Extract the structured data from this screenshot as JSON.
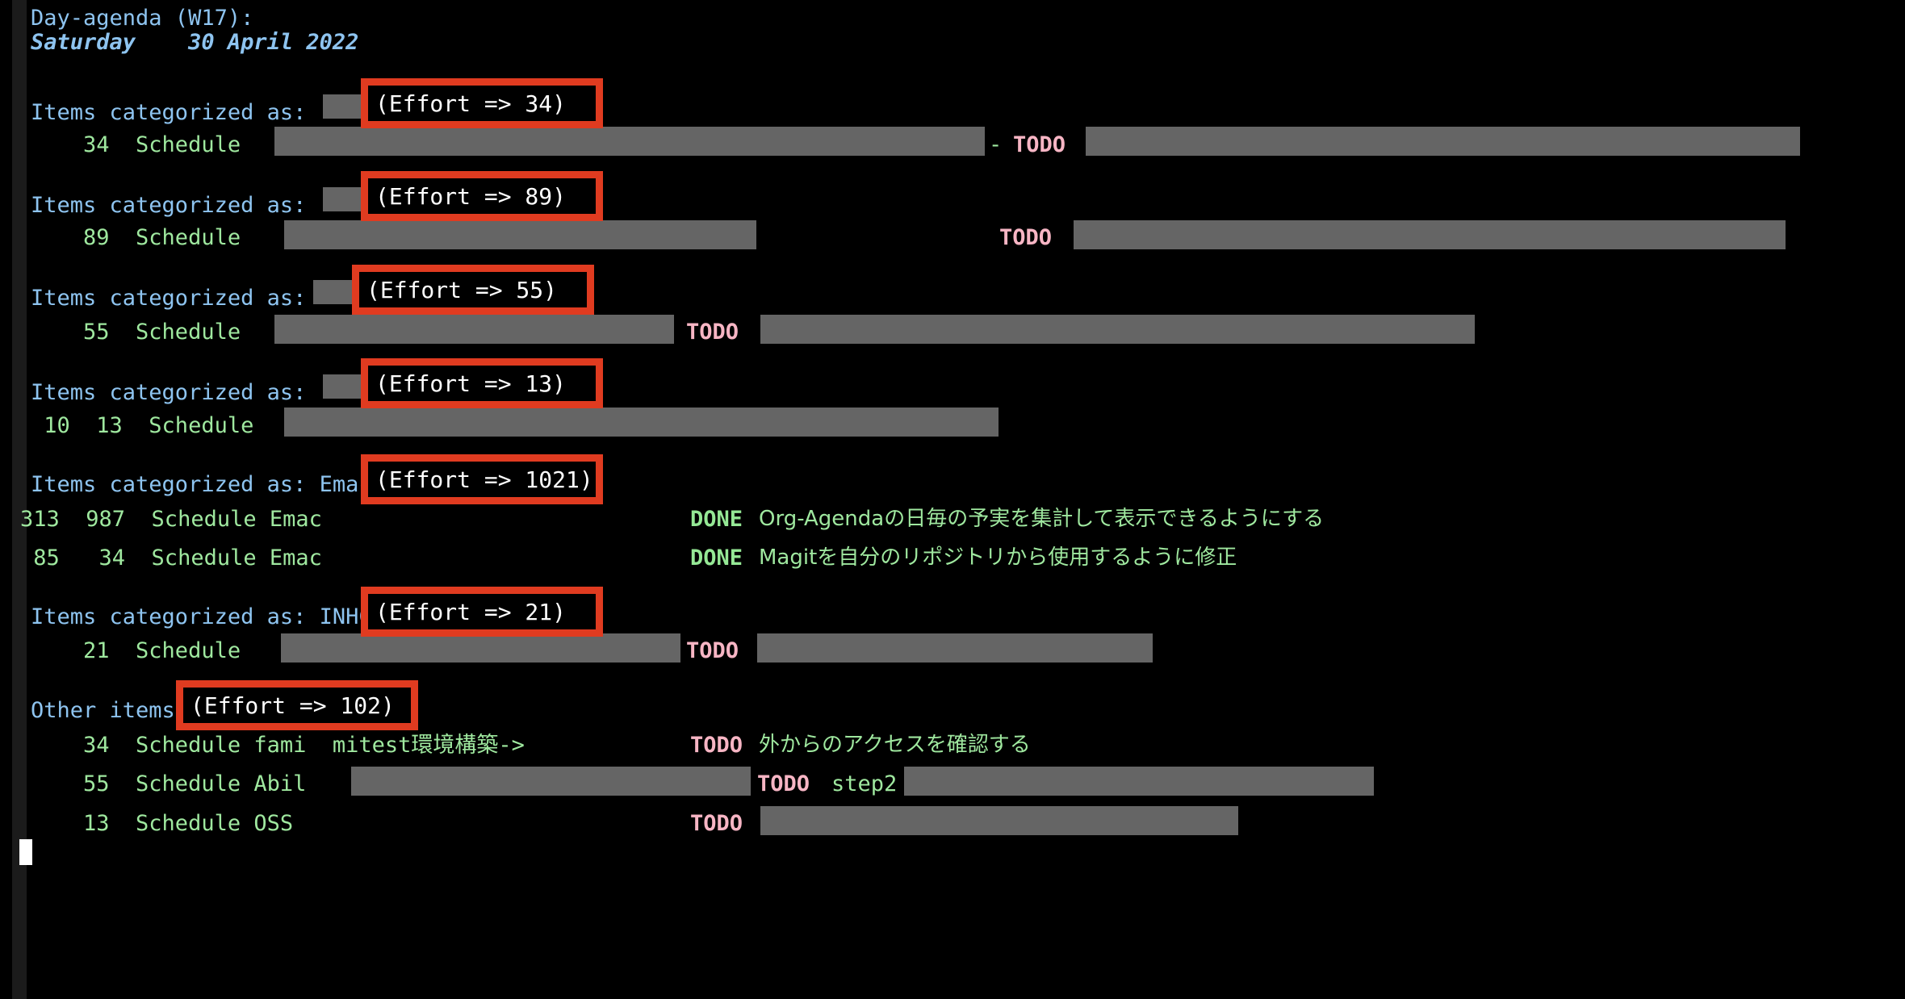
{
  "header": {
    "title": "Day-agenda (W17):",
    "date": "Saturday    30 April 2022"
  },
  "labels": {
    "items_categorized_as": "Items categorized as:",
    "other_items": "Other items",
    "schedule": "Schedule",
    "todo_keyword": "TODO",
    "done_keyword": "DONE"
  },
  "colors": {
    "background": "#000000",
    "fringe": "#1b1b1b",
    "header_blue": "#8ec4f0",
    "effort_green": "#9fe89f",
    "todo_pink": "#f7b5c4",
    "done_green": "#95e895",
    "redaction_gray": "#656565",
    "annotation_red": "#e03b20",
    "annotation_text": "#ffffff",
    "cursor": "#ffffff"
  },
  "groups": [
    {
      "id": "group-1",
      "category_prefix": "Items categorized as:",
      "category_redacted": true,
      "category_visible_suffix": "",
      "effort_total": "(Effort => 34)",
      "rows": [
        {
          "clocked": "",
          "effort": "34",
          "type": "Schedule",
          "title_visible": "",
          "title_redacted": true,
          "keyword": "TODO",
          "keyword_color": "todo_pink",
          "tail_redacted": true
        }
      ]
    },
    {
      "id": "group-2",
      "category_prefix": "Items categorized as:",
      "category_redacted": true,
      "category_visible_suffix": "",
      "effort_total": "(Effort => 89)",
      "rows": [
        {
          "clocked": "",
          "effort": "89",
          "type": "Schedule",
          "title_visible": "",
          "title_redacted": true,
          "keyword": "TODO",
          "keyword_color": "todo_pink",
          "tail_redacted": true
        }
      ]
    },
    {
      "id": "group-3",
      "category_prefix": "Items categorized as:",
      "category_redacted": true,
      "category_visible_suffix": "",
      "effort_total": "(Effort => 55)",
      "rows": [
        {
          "clocked": "",
          "effort": "55",
          "type": "Schedule",
          "title_visible": "",
          "title_redacted": true,
          "keyword": "TODO",
          "keyword_color": "todo_pink",
          "tail_redacted": true
        }
      ]
    },
    {
      "id": "group-4",
      "category_prefix": "Items categorized as:",
      "category_redacted": true,
      "category_visible_suffix": "",
      "effort_total": "(Effort => 13)",
      "rows": [
        {
          "clocked": "10",
          "effort": "13",
          "type": "Schedule",
          "title_visible": "",
          "title_redacted": true,
          "keyword": "",
          "keyword_color": "",
          "tail_redacted": false
        }
      ]
    },
    {
      "id": "group-5",
      "category_prefix": "Items categorized as: Emac",
      "category_redacted": false,
      "category_visible_suffix": "Emac",
      "effort_total": "(Effort => 1021)",
      "rows": [
        {
          "clocked": "313",
          "effort": "987",
          "type": "Schedule Emac",
          "title_visible": "Org-Agendaの日毎の予実を集計して表示できるようにする",
          "title_redacted": false,
          "keyword": "DONE",
          "keyword_color": "done_green",
          "tail_redacted": false
        },
        {
          "clocked": "85",
          "effort": "34",
          "type": "Schedule Emac",
          "title_visible": "Magitを自分のリポジトリから使用するように修正",
          "title_redacted": false,
          "keyword": "DONE",
          "keyword_color": "done_green",
          "tail_redacted": false
        }
      ]
    },
    {
      "id": "group-6",
      "category_prefix": "Items categorized as: INHC",
      "category_redacted": false,
      "category_visible_suffix": "INHC",
      "effort_total": "(Effort => 21)",
      "rows": [
        {
          "clocked": "",
          "effort": "21",
          "type": "Schedule",
          "title_visible": "",
          "title_redacted": true,
          "keyword": "TODO",
          "keyword_color": "todo_pink",
          "tail_redacted": true
        }
      ]
    },
    {
      "id": "group-7",
      "category_prefix": "Other items",
      "category_redacted": false,
      "category_visible_suffix": "",
      "effort_total": "(Effort => 102)",
      "rows": [
        {
          "clocked": "",
          "effort": "34",
          "type": "Schedule fami",
          "title_visible": "mitest環境構築->",
          "title_redacted": false,
          "keyword": "TODO",
          "keyword_color": "todo_pink",
          "tail_text": "外からのアクセスを確認する",
          "tail_redacted": false
        },
        {
          "clocked": "",
          "effort": "55",
          "type": "Schedule Abil",
          "title_visible": "",
          "title_redacted": true,
          "keyword": "TODO",
          "keyword_color": "todo_pink",
          "tail_text": "step2",
          "tail_redacted": true
        },
        {
          "clocked": "",
          "effort": "13",
          "type": "Schedule OSS",
          "title_visible": "",
          "title_redacted": false,
          "keyword": "TODO",
          "keyword_color": "todo_pink",
          "tail_text": "",
          "tail_redacted": true
        }
      ]
    }
  ],
  "annotations": [
    {
      "id": "annot-effort-34",
      "text": "(Effort => 34)"
    },
    {
      "id": "annot-effort-89",
      "text": "(Effort => 89)"
    },
    {
      "id": "annot-effort-55",
      "text": "(Effort => 55)"
    },
    {
      "id": "annot-effort-13",
      "text": "(Effort => 13)"
    },
    {
      "id": "annot-effort-1021",
      "text": "(Effort => 1021)"
    },
    {
      "id": "annot-effort-21",
      "text": "(Effort => 21)"
    },
    {
      "id": "annot-effort-102",
      "text": "(Effort => 102)"
    }
  ],
  "text_fragments": {
    "cat_1": "Items categorized as:",
    "cat_2": "Items categorized as:",
    "cat_3": "Items categorized as:",
    "cat_4": "Items categorized as:",
    "cat_5": "Items categorized as: Emac",
    "cat_6": "Items categorized as: INHC",
    "cat_7": "Other items",
    "r1": "    34  Schedule",
    "r2": "    89  Schedule",
    "r3": "    55  Schedule",
    "r4": " 10  13  Schedule",
    "r5": "313  987  Schedule Emac",
    "r6": " 85   34  Schedule Emac",
    "r7": "    21  Schedule",
    "r8": "    34  Schedule fami  mitest環境構築->",
    "r9": "    55  Schedule Abil",
    "r10": "    13  Schedule OSS",
    "todo": "TODO",
    "done": "DONE",
    "done_text_1": "Org-Agendaの日毎の予実を集計して表示できるようにする",
    "done_text_2": "Magitを自分のリポジトリから使用するように修正",
    "todo_text_1": "外からのアクセスを確認する",
    "todo_text_2": "step2"
  }
}
